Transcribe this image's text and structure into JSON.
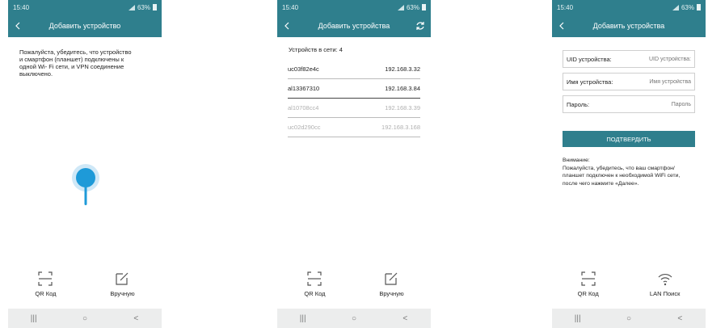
{
  "status": {
    "time": "15:40",
    "battery": "63%"
  },
  "colors": {
    "primary": "#2f7f8d",
    "accent_pin": "#1e9ad8"
  },
  "screen1": {
    "title": "Добавить устройство",
    "message_line1": "Пожалуйста, убедитесь, что устройство",
    "message_line2": "и смартфон (планшет) подключены к",
    "message_line3": "одной Wi- Fi сети, и VPN соединение",
    "message_line4": "выключено.",
    "actions": [
      "QR Код",
      "Вручную"
    ]
  },
  "screen2": {
    "title": "Добавить устройства",
    "count_label": "Устройств в сети: 4",
    "devices": [
      {
        "name": "uc03f82e4c",
        "ip": "192.168.3.32"
      },
      {
        "name": "al13367310",
        "ip": "192.168.3.84"
      },
      {
        "name": "al10708cc4",
        "ip": "192.168.3.39"
      },
      {
        "name": "uc02d290cc",
        "ip": "192.168.3.168"
      }
    ],
    "actions": [
      "QR Код",
      "Вручную"
    ]
  },
  "screen3": {
    "title": "Добавить устройства",
    "fields": [
      {
        "label": "UID устройства:",
        "placeholder": "UID устройства:"
      },
      {
        "label": "Имя устройства:",
        "placeholder": "Имя устройства"
      },
      {
        "label": "Пароль:",
        "placeholder": "Пароль"
      }
    ],
    "confirm_label": "ПОДТВЕРДИТЬ",
    "note_title": "Внимание:",
    "note_line1": "Пожалуйста, убедитесь, что ваш смартфон/",
    "note_line2": "планшет подключен к необходимой WiFi сети,",
    "note_line3": "после чего нажмите «Далее».",
    "actions": [
      "QR Код",
      "LAN Поиск"
    ]
  },
  "navbar": {
    "recent": "|||",
    "home": "○",
    "back": "<"
  }
}
